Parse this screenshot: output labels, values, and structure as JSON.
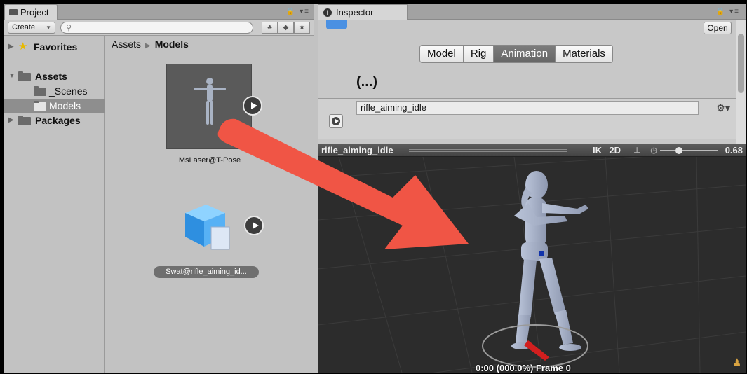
{
  "project": {
    "tab_label": "Project",
    "create_label": "Create",
    "search_placeholder": "",
    "tree": {
      "favorites": "Favorites",
      "assets": "Assets",
      "scenes": "_Scenes",
      "models": "Models",
      "packages": "Packages"
    },
    "breadcrumb": {
      "root": "Assets",
      "current": "Models"
    },
    "items": [
      {
        "label": "MsLaser@T-Pose"
      },
      {
        "label": "Swat@rifle_aiming_id..."
      }
    ]
  },
  "inspector": {
    "tab_label": "Inspector",
    "open_label": "Open",
    "tabs": [
      "Model",
      "Rig",
      "Animation",
      "Materials"
    ],
    "active_tab": "Animation",
    "ellipsis": "(...)",
    "clip_name": "rifle_aiming_idle"
  },
  "preview": {
    "clip_name": "rifle_aiming_idle",
    "ik_label": "IK",
    "twod_label": "2D",
    "speed": "0.68",
    "speed_fraction": 0.3,
    "timecode": "0:00 (000.0%) Frame 0"
  },
  "colors": {
    "arrow": "#f05545",
    "grid_bg": "#2b2b2b",
    "selection": "#8e8e8e",
    "active_tab": "#6f6f6f"
  }
}
